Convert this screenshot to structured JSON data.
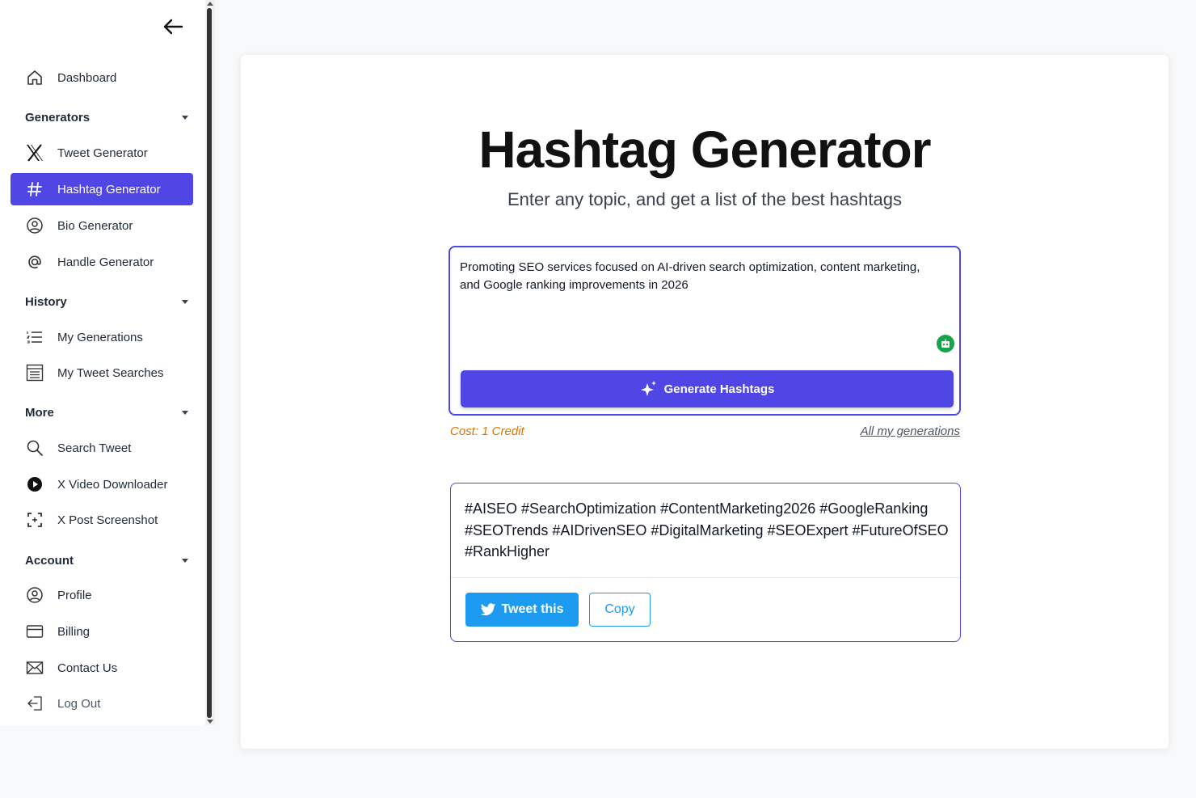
{
  "sidebar": {
    "dashboard": "Dashboard",
    "sections": {
      "generators": "Generators",
      "history": "History",
      "more": "More",
      "account": "Account"
    },
    "items": {
      "tweet_generator": "Tweet Generator",
      "hashtag_generator": "Hashtag Generator",
      "bio_generator": "Bio Generator",
      "handle_generator": "Handle Generator",
      "my_generations": "My Generations",
      "my_tweet_searches": "My Tweet Searches",
      "search_tweet": "Search Tweet",
      "x_video_downloader": "X Video Downloader",
      "x_post_screenshot": "X Post Screenshot",
      "profile": "Profile",
      "billing": "Billing",
      "contact_us": "Contact Us",
      "log_out": "Log Out"
    },
    "active": "hashtag_generator"
  },
  "main": {
    "title": "Hashtag Generator",
    "subtitle": "Enter any topic, and get a list of the best hashtags",
    "topic_input": "Promoting SEO services focused on AI-driven search optimization, content marketing, and Google ranking improvements in 2026",
    "generate_label": "Generate Hashtags",
    "cost": "Cost: 1 Credit",
    "all_generations": "All my generations",
    "result": "#AISEO #SearchOptimization #ContentMarketing2026 #GoogleRanking #SEOTrends #AIDrivenSEO #DigitalMarketing #SEOExpert #FutureOfSEO #RankHigher",
    "tweet_label": "Tweet this",
    "copy_label": "Copy"
  },
  "colors": {
    "accent": "#4f46e5",
    "twitter": "#1d9bf0",
    "cost": "#d97706",
    "robot": "#16a34a"
  }
}
